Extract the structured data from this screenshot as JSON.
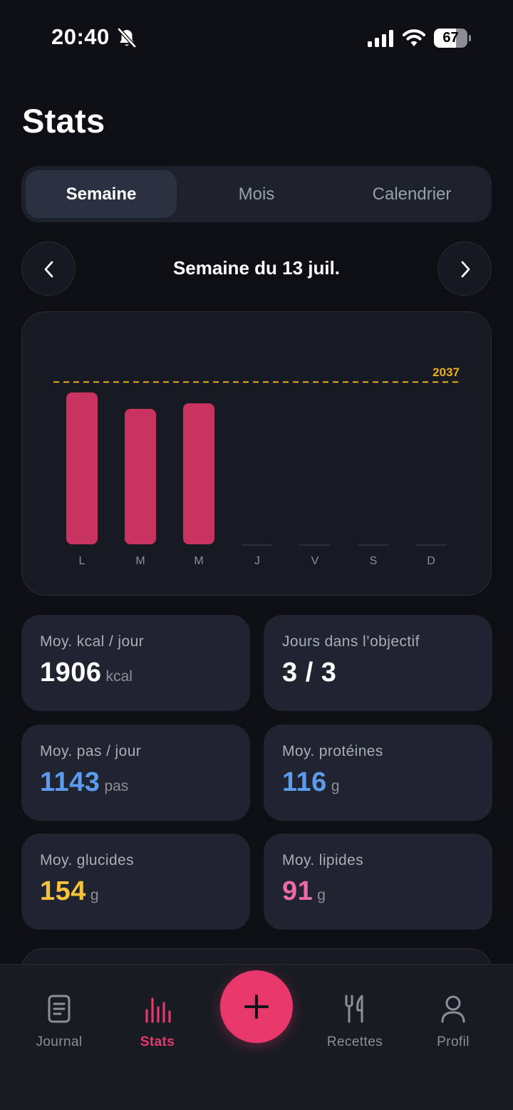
{
  "status_bar": {
    "time": "20:40",
    "battery": "67",
    "battery_level": 0.67
  },
  "page": {
    "title": "Stats"
  },
  "tabs": [
    {
      "label": "Semaine",
      "active": true
    },
    {
      "label": "Mois",
      "active": false
    },
    {
      "label": "Calendrier",
      "active": false
    }
  ],
  "week": {
    "label": "Semaine du 13 juil."
  },
  "chart_data": {
    "type": "bar",
    "categories": [
      "L",
      "M",
      "M",
      "J",
      "V",
      "S",
      "D"
    ],
    "values": [
      1906,
      1700,
      1770,
      0,
      0,
      0,
      0
    ],
    "goal": 2037,
    "goal_label": "2037",
    "ylim": [
      0,
      2200
    ],
    "bar_color": "#c9335f",
    "goal_color": "#e8b020"
  },
  "stats": {
    "kcal": {
      "label": "Moy. kcal / jour",
      "value": "1906",
      "unit": "kcal",
      "color": "#ffffff"
    },
    "days": {
      "label": "Jours dans l’objectif",
      "value": "3 / 3",
      "color": "#ffffff"
    },
    "steps": {
      "label": "Moy. pas / jour",
      "value": "1143",
      "unit": "pas",
      "color": "#5b9cf0"
    },
    "protein": {
      "label": "Moy. protéines",
      "value": "116",
      "unit": "g",
      "color": "#5b9cf0"
    },
    "carbs": {
      "label": "Moy. glucides",
      "value": "154",
      "unit": "g",
      "color": "#f5c33b"
    },
    "fat": {
      "label": "Moy. lipides",
      "value": "91",
      "unit": "g",
      "color": "#ec6aa5"
    }
  },
  "nav": {
    "journal": "Journal",
    "stats": "Stats",
    "recipes": "Recettes",
    "profile": "Profil",
    "accent": "#e8386b"
  }
}
